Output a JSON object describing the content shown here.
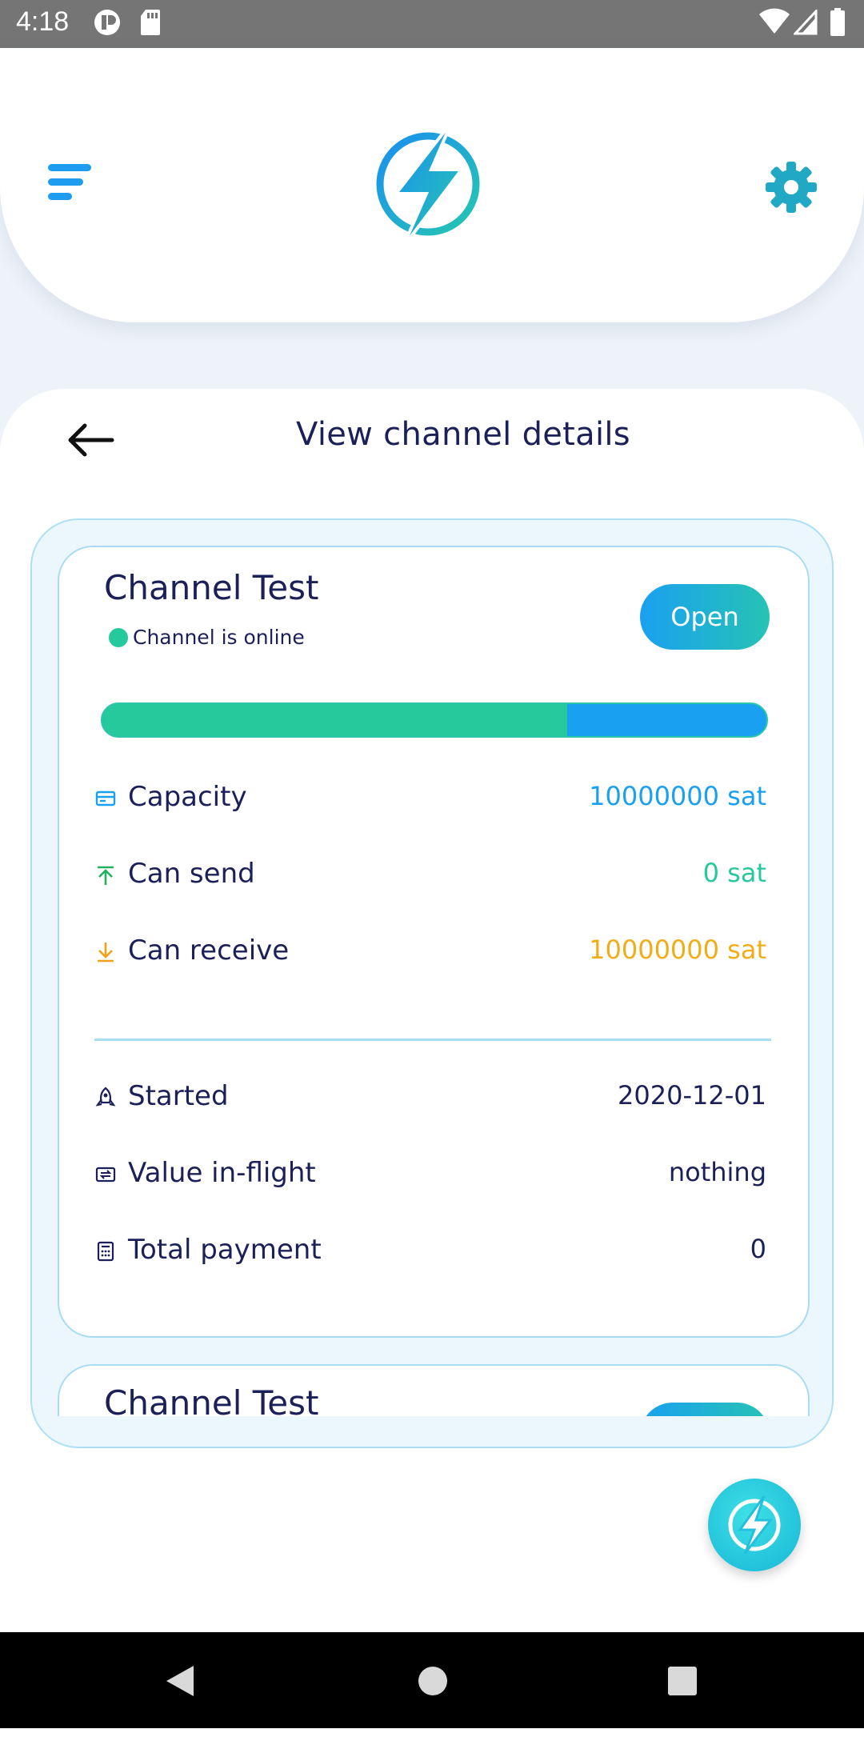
{
  "status_bar": {
    "time": "4:18"
  },
  "header": {
    "menu_icon": "menu-icon",
    "logo_icon": "lightning-bolt-logo",
    "settings_icon": "gear-icon"
  },
  "page": {
    "title": "View channel details",
    "back_icon": "arrow-left-icon"
  },
  "channel": {
    "name": "Channel Test",
    "status_text": "Channel is online",
    "status_button": "Open",
    "balance_send_fraction": 0.7,
    "rows": [
      {
        "icon": "credit-card-icon",
        "label": "Capacity",
        "value": "10000000 sat",
        "color": "#1aa0f0"
      },
      {
        "icon": "arrow-up-icon",
        "label": "Can send",
        "value": "0 sat",
        "color": "#26c99c"
      },
      {
        "icon": "arrow-down-icon",
        "label": "Can receive",
        "value": "10000000 sat",
        "color": "#f0ad1a"
      }
    ],
    "details": [
      {
        "icon": "rocket-icon",
        "label": "Started",
        "value": "2020-12-01"
      },
      {
        "icon": "transfer-icon",
        "label": "Value in-flight",
        "value": "nothing"
      },
      {
        "icon": "calculator-icon",
        "label": "Total payment",
        "value": "0"
      }
    ]
  },
  "next_channel": {
    "name": "Channel Test"
  },
  "colors": {
    "accent": "#1aa0f0",
    "green": "#26c99c",
    "orange": "#f0ad1a",
    "text": "#1b2158"
  }
}
